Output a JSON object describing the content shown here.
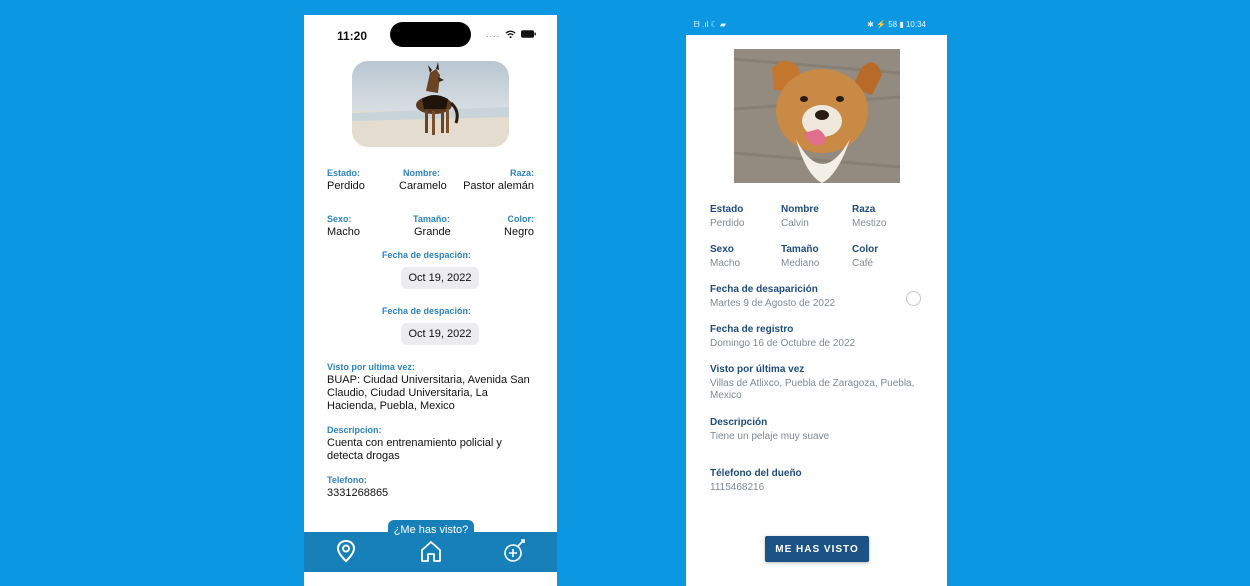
{
  "ios": {
    "status": {
      "time": "11:20",
      "dots": "...."
    },
    "fields": {
      "estado_label": "Estado:",
      "estado_value": "Perdido",
      "nombre_label": "Nombre:",
      "nombre_value": "Caramelo",
      "raza_label": "Raza:",
      "raza_value": "Pastor alemán",
      "sexo_label": "Sexo:",
      "sexo_value": "Macho",
      "tamano_label": "Tamaño:",
      "tamano_value": "Grande",
      "color_label": "Color:",
      "color_value": "Negro"
    },
    "fecha1_label": "Fecha de despación:",
    "fecha1_value": "Oct 19, 2022",
    "fecha2_label": "Fecha de despación:",
    "fecha2_value": "Oct 19, 2022",
    "visto_label": "Visto por ultima vez:",
    "visto_value": "BUAP: Ciudad Universitaria, Avenida San Claudio, Ciudad Universitaria, La Hacienda, Puebla, Mexico",
    "descripcion_label": "Descripcion:",
    "descripcion_value": "Cuenta con entrenamiento policial y detecta drogas",
    "telefono_label": "Telefono:",
    "telefono_value": "3331268865",
    "tooltip": "¿Me has visto?",
    "tabs": [
      "location-pin-icon",
      "home-icon",
      "add-pet-icon"
    ]
  },
  "android": {
    "status": {
      "left": "ᗷ .ıl ☾ ▰",
      "right": "✱ ⚡ 58 ▮ 10:34"
    },
    "fields": {
      "estado_label": "Estado",
      "estado_value": "Perdido",
      "nombre_label": "Nombre",
      "nombre_value": "Calvin",
      "raza_label": "Raza",
      "raza_value": "Mestizo",
      "sexo_label": "Sexo",
      "sexo_value": "Macho",
      "tamano_label": "Tamaño",
      "tamano_value": "Mediano",
      "color_label": "Color",
      "color_value": "Café"
    },
    "fecha_desap_label": "Fecha de desaparición",
    "fecha_desap_value": "Martes 9 de Agosto de 2022",
    "fecha_registro_label": "Fecha de registro",
    "fecha_registro_value": "Domingo 16 de Octubre de 2022",
    "visto_label": "Visto por última vez",
    "visto_value": "Villas de Atlixco, Puebla de Zaragoza, Puebla, Mexico",
    "descripcion_label": "Descripción",
    "descripcion_value": "Tiene un pelaje muy suave",
    "telefono_label": "Télefono del dueño",
    "telefono_value": "1115468216",
    "button": "ME HAS VISTO"
  },
  "colors": {
    "background": "#0b97e2",
    "ios_label": "#2f84c4",
    "ios_tabbar": "#1780b8",
    "android_label": "#1e4d7d",
    "android_button": "#1b5386"
  }
}
